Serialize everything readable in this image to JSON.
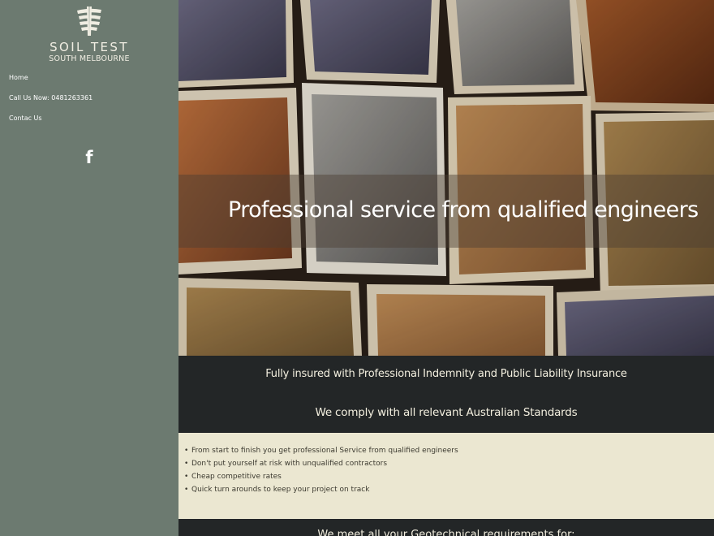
{
  "brand": {
    "title": "SOIL TEST",
    "subtitle": "SOUTH MELBOURNE",
    "logo_icon": "screw-pile-icon"
  },
  "nav": {
    "items": [
      {
        "label": "Home"
      },
      {
        "label": "Call Us Now: 0481263361"
      },
      {
        "label": "Contac Us"
      }
    ]
  },
  "social": {
    "facebook_glyph": "f",
    "icon": "facebook-icon"
  },
  "hero": {
    "headline": "Professional service from qualified engineers",
    "image": "boxes of soil samples"
  },
  "highlights": {
    "insured": "Fully insured with Professional Indemnity and Public Liability Insurance",
    "standards": "We comply with all relevant Australian Standards"
  },
  "benefits": [
    "From start to finish you get professional Service from qualified engineers",
    "Don't put yourself at risk with unqualified contractors",
    "Cheap competitive rates",
    "Quick turn arounds to keep your project on track"
  ],
  "bottom": {
    "heading": "We meet all your Geotechnical requirements for:"
  },
  "colors": {
    "sidebar": "#6c7a70",
    "dark": "#232627",
    "cream": "#ebe7d1",
    "text_light": "#f3efdf"
  }
}
